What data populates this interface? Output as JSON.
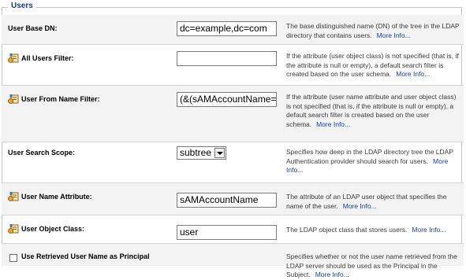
{
  "section": {
    "legend": "Users"
  },
  "rows": [
    {
      "label": "User Base DN:",
      "value": "dc=example,dc=com",
      "description": "The base distinguished name (DN) of the tree in the LDAP directory that contains users.",
      "more": "More Info..."
    },
    {
      "label": "All Users Filter:",
      "value": "",
      "description": "If the attribute (user object class) is not specified (that is, if the attribute is null or empty), a default search filter is created based on the user schema.",
      "more": "More Info..."
    },
    {
      "label": "User From Name Filter:",
      "value": "(&(sAMAccountName=%",
      "description": "If the attribute (user name attribute and user object class) is not specified (that is, if the attribute is null or empty), a default search filter is created based on the user schema.",
      "more": "More Info..."
    },
    {
      "label": "User Search Scope:",
      "value": "subtree",
      "description": "Specifies how deep in the LDAP directory tree the LDAP Authentication provider should search for users.",
      "more": "More Info..."
    },
    {
      "label": "User Name Attribute:",
      "value": "sAMAccountName",
      "description": "The attribute of an LDAP user object that specifies the name of the user.",
      "more": "More Info..."
    },
    {
      "label": "User Object Class:",
      "value": "user",
      "description": "The LDAP object class that stores users.",
      "more": "More Info..."
    },
    {
      "label": "Use Retrieved User Name as Principal",
      "checked": false,
      "description": "Specifies whether or not the user name retrieved from the LDAP server should be used as the Principal in the Subject.",
      "more": "More Info..."
    }
  ],
  "icons": {
    "dynamic": "dynamic-attribute-icon"
  },
  "colors": {
    "legend": "#1a3b7a",
    "link": "#1a3fa3",
    "alt_row": "#f3f3f3"
  }
}
